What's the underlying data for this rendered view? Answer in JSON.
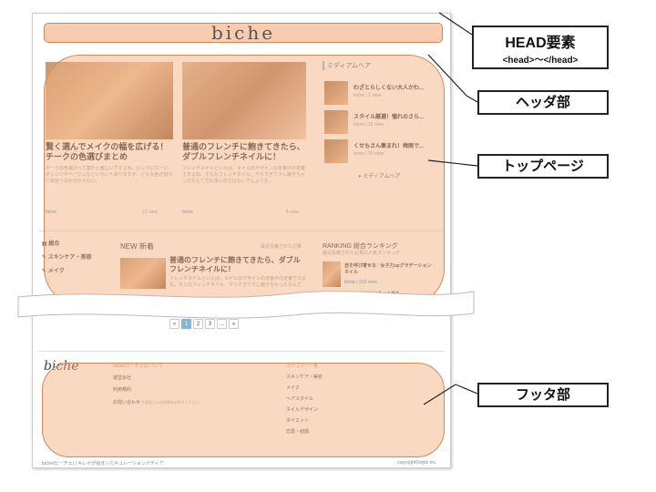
{
  "site": {
    "logo": "biche",
    "featured": [
      {
        "title": "賢く選んでメイクの幅を広げる！チークの色選びまとめ",
        "text": "チークの色選びって案外と難しいですよね。ピンクにローズ、オレンジやベージュなどいろいろありますが、どんな色が自分に似合うのか分からない。",
        "author": "biche",
        "views": "12 view"
      },
      {
        "title": "普通のフレンチに飽きてきたら、ダブルフレンチネイルに！",
        "text": "フレンチネイルといえば、ネイルのデザインの定番中の定番ですよね。そんなフレンチネイル、やりすぎて少し飽きちゃったなんて方も多いのではないでしょうか。",
        "author": "biche",
        "views": "5 view"
      }
    ],
    "sidebar_title": "ミディアムヘア",
    "sidebar_items": [
      {
        "title": "わざとらしくない大人かわ…",
        "meta": "biche | 2 view"
      },
      {
        "title": "スタイル厳選！憧れのさら…",
        "meta": "biche | 12 view"
      },
      {
        "title": "くせもさん集まれ！梅雨で…",
        "meta": "biche | 50 view"
      }
    ],
    "sidebar_more": "ミディアムヘア",
    "nav": [
      "総合",
      "スキンケア・美容",
      "メイク"
    ],
    "new_label": "NEW 新着",
    "new_sub": "最近投稿された記事",
    "new_title": "普通のフレンチに飽きてきたら、ダブルフレンチネイルに！",
    "new_text": "フレンチネイルといえば、ネイルのデザインの定番中の定番ですよね。そんなフレンチネイル、やりすぎて少し飽きちゃったなんて",
    "ranking_label": "RANKING 総合ランキング",
    "ranking_sub": "最近投稿された記事の人気ランキング",
    "ranking_item": "自を呼び寄せる♡女子力upグラデーションネイル",
    "ranking_meta": "biche | 319 view",
    "ranking_item2": "最初に利用すれば… 人気も…",
    "pager": [
      "«",
      "1",
      "2",
      "3",
      "…",
      "»"
    ],
    "footer_logo": "biche",
    "footer_col1": [
      "biche(ビーチェ)について",
      "運営会社",
      "利用規約",
      "お問い合わせ"
    ],
    "footer_col1_note": "※返信とのお時間をお待ちください",
    "footer_col2_title": "カテゴリー一覧",
    "footer_col2": [
      "スキンケア・美容",
      "メイク",
      "ヘアスタイル",
      "ネイルデザイン",
      "ダイエット",
      "恋愛・結婚"
    ],
    "footer_bottom_left": "biche(ビーチェ) | キレイが始まったキュレーションメディア",
    "footer_bottom_right": "copyright©style inc."
  },
  "callouts": {
    "head_title": "HEAD要素",
    "head_sub": "<head>〜</head>",
    "header": "ヘッダ部",
    "top": "トップページ",
    "footer": "フッタ部"
  },
  "colors": {
    "overlay": "#f4aa78",
    "accent": "#7fb8d8"
  }
}
